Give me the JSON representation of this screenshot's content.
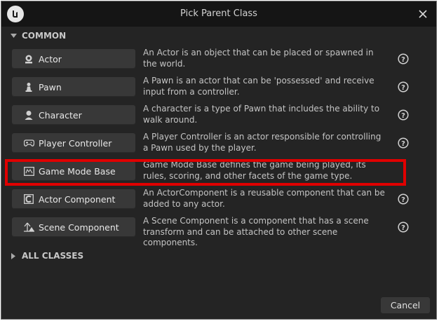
{
  "dialog": {
    "title": "Pick Parent Class"
  },
  "sections": {
    "common": "COMMON",
    "all_classes": "ALL CLASSES"
  },
  "classes": [
    {
      "label": "Actor",
      "icon": "actor-icon",
      "description": "An Actor is an object that can be placed or spawned in the world."
    },
    {
      "label": "Pawn",
      "icon": "pawn-icon",
      "description": "A Pawn is an actor that can be 'possessed' and receive input from a controller."
    },
    {
      "label": "Character",
      "icon": "character-icon",
      "description": "A character is a type of Pawn that includes the ability to walk around."
    },
    {
      "label": "Player Controller",
      "icon": "gamepad-icon",
      "description": "A Player Controller is an actor responsible for controlling a Pawn used by the player."
    },
    {
      "label": "Game Mode Base",
      "icon": "game-mode-icon",
      "description": "Game Mode Base defines the game being played, its rules, scoring, and other facets of the game type."
    },
    {
      "label": "Actor Component",
      "icon": "actor-component-icon",
      "description": "An ActorComponent is a reusable component that can be added to any actor."
    },
    {
      "label": "Scene Component",
      "icon": "scene-component-icon",
      "description": "A Scene Component is a component that has a scene transform and can be attached to other scene components."
    }
  ],
  "footer": {
    "cancel_label": "Cancel"
  },
  "colors": {
    "highlight": "#e00000",
    "background": "#242424",
    "button": "#383838"
  }
}
